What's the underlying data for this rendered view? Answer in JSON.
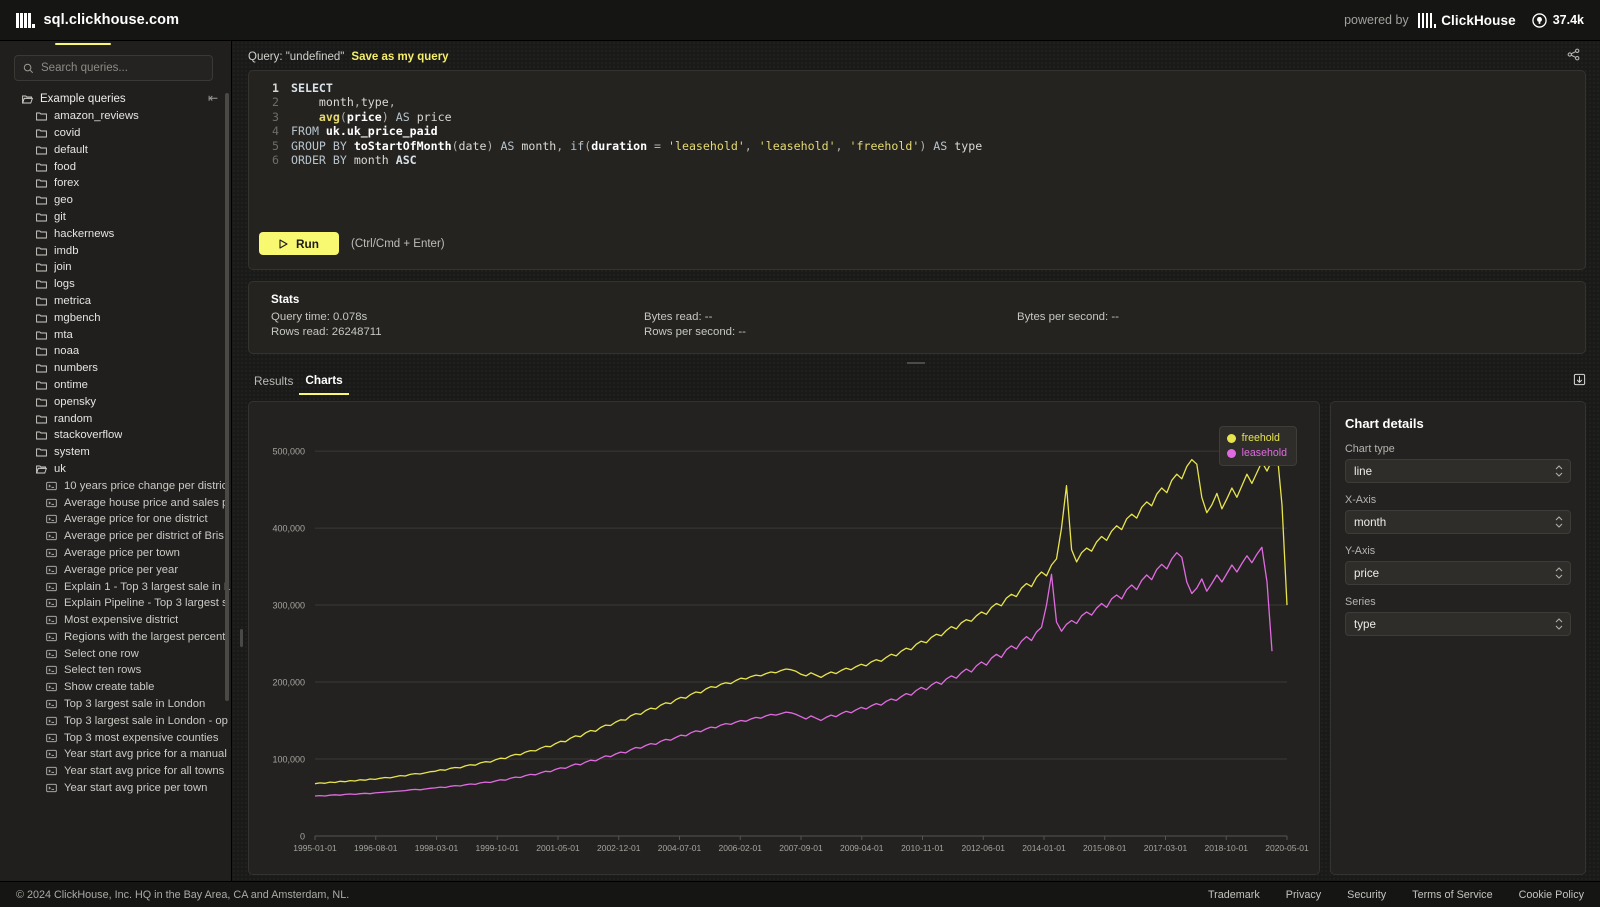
{
  "topbar": {
    "site_title": "sql.clickhouse.com",
    "powered_by": "powered by",
    "brand_name": "ClickHouse",
    "github_stars": "37.4k",
    "logo_icon": "clickhouse-logo-icon",
    "github_icon": "github-icon"
  },
  "sidebar": {
    "search": {
      "placeholder": "Search queries...",
      "value": "",
      "icon": "search-icon"
    },
    "collapse_icon": "collapse-sidebar-icon",
    "root": {
      "label": "Example queries",
      "icon": "folder-open-icon"
    },
    "databases": [
      {
        "label": "amazon_reviews"
      },
      {
        "label": "covid"
      },
      {
        "label": "default"
      },
      {
        "label": "food"
      },
      {
        "label": "forex"
      },
      {
        "label": "geo"
      },
      {
        "label": "git"
      },
      {
        "label": "hackernews"
      },
      {
        "label": "imdb"
      },
      {
        "label": "join"
      },
      {
        "label": "logs"
      },
      {
        "label": "metrica"
      },
      {
        "label": "mgbench"
      },
      {
        "label": "mta"
      },
      {
        "label": "noaa"
      },
      {
        "label": "numbers"
      },
      {
        "label": "ontime"
      },
      {
        "label": "opensky"
      },
      {
        "label": "random"
      },
      {
        "label": "stackoverflow"
      },
      {
        "label": "system"
      }
    ],
    "expanded_db": {
      "label": "uk",
      "icon": "folder-open-icon"
    },
    "queries": [
      {
        "label": "10 years price change per distric"
      },
      {
        "label": "Average house price and sales p"
      },
      {
        "label": "Average price for one district"
      },
      {
        "label": "Average price per district of Bris"
      },
      {
        "label": "Average price per town"
      },
      {
        "label": "Average price per year"
      },
      {
        "label": "Explain 1 - Top 3 largest sale in L"
      },
      {
        "label": "Explain Pipeline - Top 3 largest s"
      },
      {
        "label": "Most expensive district"
      },
      {
        "label": "Regions with the largest percent"
      },
      {
        "label": "Select one row"
      },
      {
        "label": "Select ten rows"
      },
      {
        "label": "Show create table"
      },
      {
        "label": "Top 3 largest sale in London"
      },
      {
        "label": "Top 3 largest sale in London - op"
      },
      {
        "label": "Top 3 most expensive counties"
      },
      {
        "label": "Year start avg price for a manual"
      },
      {
        "label": "Year start avg price for all towns"
      },
      {
        "label": "Year start avg price per town"
      }
    ]
  },
  "query_header": {
    "label": "Query: \"undefined\"",
    "save_link": "Save as my query",
    "share_icon": "share-icon"
  },
  "editor": {
    "lines": [
      "1",
      "2",
      "3",
      "4",
      "5",
      "6"
    ],
    "sql": "SELECT\n    month,type,\n    avg(price) AS price\nFROM uk.uk_price_paid\nGROUP BY toStartOfMonth(date) AS month, if(duration = 'leasehold', 'leasehold', 'freehold') AS type\nORDER BY month ASC",
    "run_label": "Run",
    "run_icon": "play-icon",
    "run_hint": "(Ctrl/Cmd + Enter)"
  },
  "stats": {
    "title": "Stats",
    "columns": [
      [
        {
          "text": "Query time: 0.078s"
        },
        {
          "text": "Rows read: 26248711"
        }
      ],
      [
        {
          "text": "Bytes read: --"
        },
        {
          "text": "Rows per second: --"
        }
      ],
      [
        {
          "text": "Bytes per second: --"
        }
      ]
    ]
  },
  "result_tabs": {
    "items": [
      {
        "label": "Results",
        "active": false
      },
      {
        "label": "Charts",
        "active": true
      }
    ],
    "export_icon": "export-icon"
  },
  "chart_details": {
    "title": "Chart details",
    "fields": [
      {
        "label": "Chart type",
        "value": "line",
        "name": "chart-type-select"
      },
      {
        "label": "X-Axis",
        "value": "month",
        "name": "x-axis-select"
      },
      {
        "label": "Y-Axis",
        "value": "price",
        "name": "y-axis-select"
      },
      {
        "label": "Series",
        "value": "type",
        "name": "series-select"
      }
    ]
  },
  "chart_data": {
    "type": "line",
    "title": "",
    "xlabel": "",
    "ylabel": "",
    "grid": true,
    "legend_position": "top-right",
    "ylim": [
      0,
      530000
    ],
    "ytick_labels": [
      "0",
      "100,000",
      "200,000",
      "300,000",
      "400,000",
      "500,000"
    ],
    "ytick_values": [
      0,
      100000,
      200000,
      300000,
      400000,
      500000
    ],
    "xtick_labels": [
      "1995-01-01",
      "1996-08-01",
      "1998-03-01",
      "1999-10-01",
      "2001-05-01",
      "2002-12-01",
      "2004-07-01",
      "2006-02-01",
      "2007-09-01",
      "2009-04-01",
      "2010-11-01",
      "2012-06-01",
      "2014-01-01",
      "2015-08-01",
      "2017-03-01",
      "2018-10-01",
      "2020-05-01"
    ],
    "series": [
      {
        "name": "freehold",
        "color": "#e8e44e",
        "values": [
          68000,
          69000,
          68500,
          70000,
          69500,
          71000,
          70500,
          72000,
          71500,
          73000,
          72500,
          74000,
          73500,
          75000,
          76000,
          75500,
          77000,
          78500,
          78000,
          80000,
          81000,
          80500,
          82000,
          83500,
          84000,
          86000,
          85500,
          88000,
          89000,
          88500,
          91000,
          92500,
          92000,
          95000,
          96500,
          96000,
          99000,
          101000,
          100500,
          104000,
          106000,
          105500,
          109000,
          111000,
          110500,
          114000,
          116500,
          116000,
          120000,
          123000,
          122500,
          127000,
          130000,
          129000,
          134000,
          137000,
          136000,
          141000,
          144000,
          143500,
          148000,
          151000,
          150500,
          156000,
          159000,
          158000,
          163000,
          166000,
          165000,
          170000,
          173000,
          172000,
          177000,
          180000,
          179000,
          184000,
          187000,
          186000,
          191000,
          194000,
          193000,
          197000,
          199000,
          198000,
          202000,
          205000,
          204000,
          207000,
          209000,
          208000,
          211000,
          213000,
          212000,
          215000,
          217000,
          216000,
          214000,
          210000,
          208000,
          212000,
          209000,
          206000,
          210000,
          213000,
          211000,
          215000,
          218000,
          216000,
          220000,
          223000,
          221000,
          226000,
          229000,
          227000,
          232000,
          236000,
          234000,
          240000,
          244000,
          242000,
          249000,
          253000,
          251000,
          258000,
          262000,
          260000,
          267000,
          272000,
          269000,
          277000,
          281000,
          279000,
          286000,
          291000,
          288000,
          297000,
          302000,
          299000,
          309000,
          314000,
          311000,
          322000,
          328000,
          324000,
          336000,
          343000,
          338000,
          352000,
          360000,
          400000,
          455000,
          372000,
          356000,
          368000,
          374000,
          370000,
          382000,
          389000,
          384000,
          396000,
          403000,
          398000,
          412000,
          418000,
          413000,
          427000,
          434000,
          429000,
          444000,
          452000,
          446000,
          462000,
          470000,
          464000,
          480000,
          489000,
          483000,
          440000,
          420000,
          430000,
          445000,
          425000,
          438000,
          452000,
          440000,
          455000,
          470000,
          458000,
          472000,
          486000,
          474000,
          488000,
          500000,
          430000,
          300000
        ]
      },
      {
        "name": "leasehold",
        "color": "#e06be0",
        "values": [
          52000,
          52500,
          52000,
          53000,
          53500,
          53000,
          54000,
          54500,
          54000,
          55000,
          55500,
          55000,
          56000,
          56500,
          57000,
          57500,
          58000,
          58500,
          59000,
          60000,
          60500,
          60000,
          61000,
          62000,
          62500,
          63500,
          63000,
          64500,
          65500,
          65000,
          66500,
          67500,
          67000,
          69000,
          70000,
          69500,
          71500,
          73000,
          72500,
          75000,
          76500,
          76000,
          78500,
          80000,
          79500,
          82000,
          84000,
          83500,
          86500,
          88500,
          88000,
          91000,
          93500,
          92500,
          96000,
          98500,
          97500,
          101000,
          104000,
          103000,
          106500,
          109000,
          108000,
          112000,
          115000,
          114000,
          117500,
          120000,
          119000,
          123000,
          125500,
          124500,
          128000,
          131000,
          130000,
          134000,
          136500,
          135500,
          139000,
          141500,
          140500,
          144000,
          146000,
          145000,
          148000,
          150000,
          149000,
          152000,
          154000,
          153000,
          156000,
          158000,
          157000,
          159000,
          161000,
          160000,
          158000,
          155000,
          152000,
          156000,
          153000,
          150000,
          154000,
          157000,
          155000,
          159000,
          162000,
          160000,
          164000,
          167000,
          165000,
          169000,
          172000,
          170000,
          175000,
          178000,
          176000,
          181000,
          185000,
          183000,
          189000,
          193000,
          190000,
          196000,
          200000,
          197000,
          204000,
          208000,
          205000,
          212000,
          217000,
          213000,
          221000,
          226000,
          222000,
          231000,
          236000,
          232000,
          242000,
          247000,
          243000,
          253000,
          259000,
          254000,
          265000,
          271000,
          300000,
          340000,
          278000,
          266000,
          275000,
          280000,
          276000,
          286000,
          291000,
          287000,
          296000,
          302000,
          297000,
          308000,
          313000,
          308000,
          320000,
          326000,
          320000,
          332000,
          339000,
          333000,
          346000,
          353000,
          347000,
          360000,
          368000,
          362000,
          330000,
          315000,
          322000,
          334000,
          318000,
          328000,
          339000,
          330000,
          341000,
          352000,
          343000,
          354000,
          364000,
          355000,
          366000,
          375000,
          330000,
          240000
        ]
      }
    ]
  },
  "footer": {
    "copyright": "© 2024 ClickHouse, Inc. HQ in the Bay Area, CA and Amsterdam, NL.",
    "links": [
      {
        "label": "Trademark"
      },
      {
        "label": "Privacy"
      },
      {
        "label": "Security"
      },
      {
        "label": "Terms of Service"
      },
      {
        "label": "Cookie Policy"
      }
    ]
  }
}
